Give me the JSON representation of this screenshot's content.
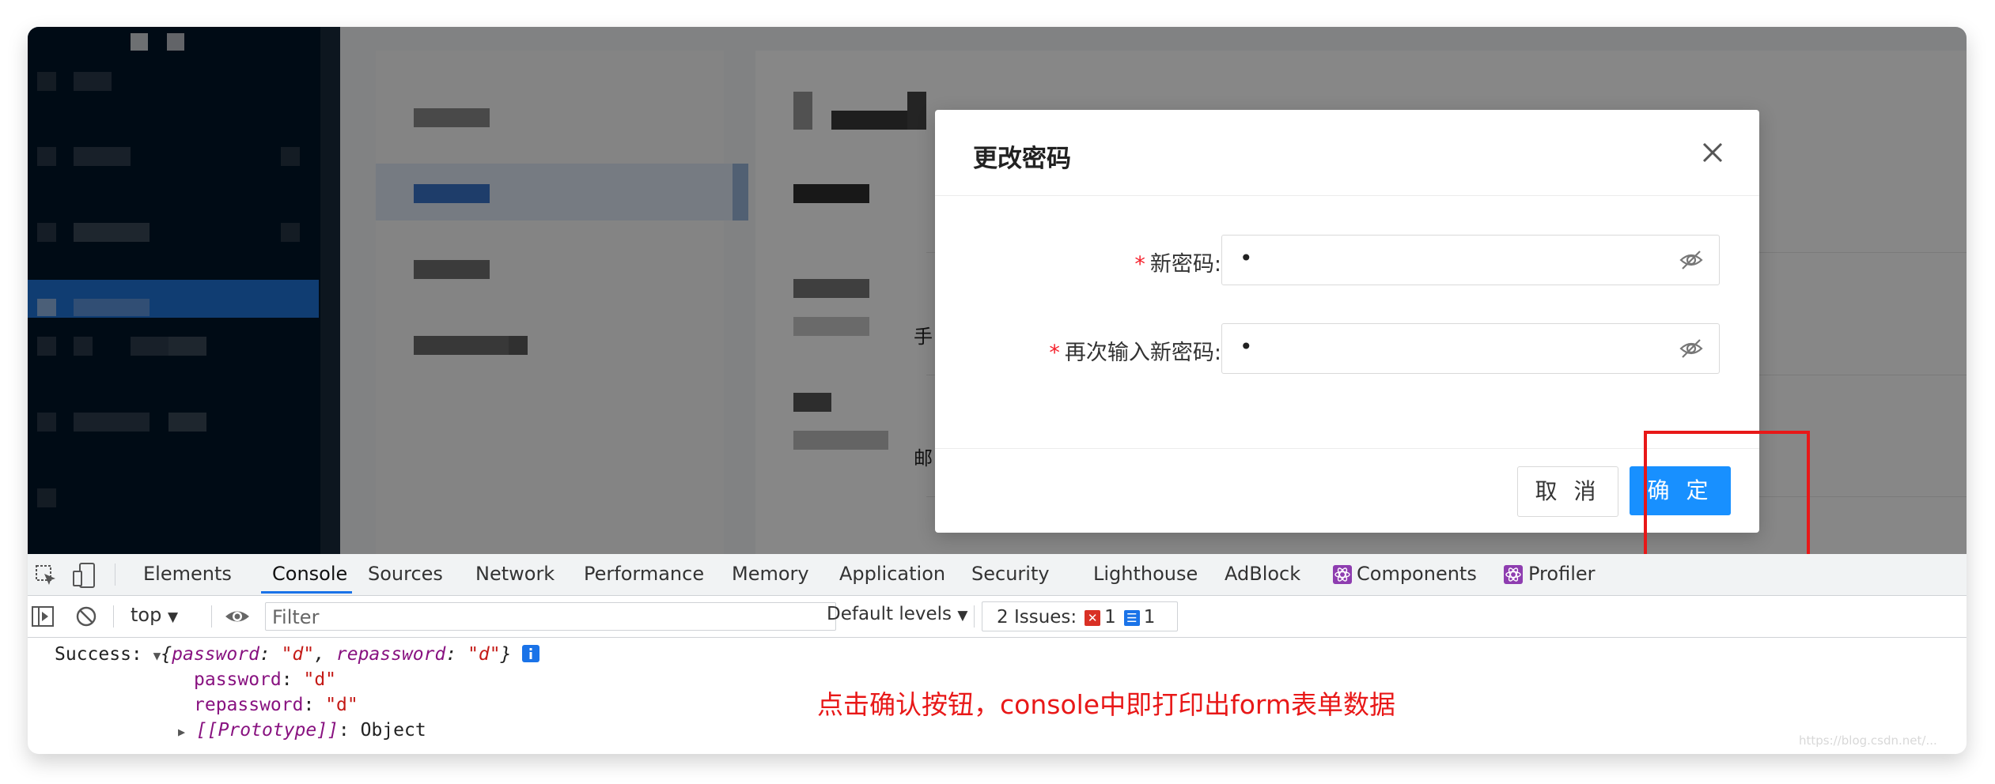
{
  "modal": {
    "title": "更改密码",
    "fields": [
      {
        "label": "新密码:",
        "value": "•"
      },
      {
        "label": "再次输入新密码:",
        "value": "•"
      }
    ],
    "required_mark": "*",
    "cancel_label": "取 消",
    "ok_label": "确 定"
  },
  "background": {
    "side_chars": [
      "手",
      "邮"
    ]
  },
  "devtools": {
    "tabs": [
      "Elements",
      "Console",
      "Sources",
      "Network",
      "Performance",
      "Memory",
      "Application",
      "Security",
      "Lighthouse",
      "AdBlock",
      "Components",
      "Profiler"
    ],
    "active_tab": "Console",
    "context": "top",
    "filter_placeholder": "Filter",
    "levels": "Default levels",
    "issues": {
      "label": "2 Issues:",
      "errors": "1",
      "messages": "1"
    }
  },
  "console": {
    "success_prefix": "Success:",
    "summary": {
      "open": "{",
      "key1": "password",
      "val1": "\"d\"",
      "key2": "repassword",
      "val2": "\"d\"",
      "close": "}"
    },
    "props": [
      {
        "key": "password",
        "value": "\"d\""
      },
      {
        "key": "repassword",
        "value": "\"d\""
      }
    ],
    "prototype_key": "[[Prototype]]",
    "prototype_value": "Object"
  },
  "annotation": "点击确认按钮，console中即打印出form表单数据",
  "watermark": "https://blog.csdn.net/...",
  "colors": {
    "primary": "#1890ff",
    "required": "#f5222d",
    "annotation": "#e81818",
    "console_key": "#881280",
    "console_string": "#c41a16"
  }
}
